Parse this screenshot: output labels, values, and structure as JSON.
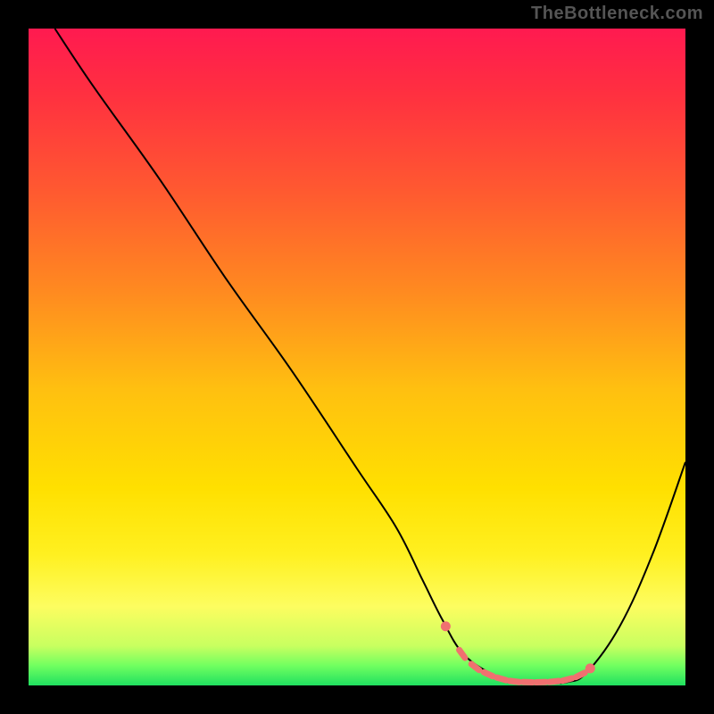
{
  "watermark": "TheBottleneck.com",
  "colors": {
    "background": "#000000",
    "gradient_stops": [
      {
        "offset": 0,
        "color": "#ff1a50"
      },
      {
        "offset": 0.1,
        "color": "#ff3040"
      },
      {
        "offset": 0.25,
        "color": "#ff5a30"
      },
      {
        "offset": 0.4,
        "color": "#ff8a20"
      },
      {
        "offset": 0.55,
        "color": "#ffc010"
      },
      {
        "offset": 0.7,
        "color": "#ffe000"
      },
      {
        "offset": 0.8,
        "color": "#fff020"
      },
      {
        "offset": 0.88,
        "color": "#fdfd60"
      },
      {
        "offset": 0.94,
        "color": "#c8ff60"
      },
      {
        "offset": 0.97,
        "color": "#70ff60"
      },
      {
        "offset": 1.0,
        "color": "#20e060"
      }
    ],
    "curve": "#000000",
    "marker": "#f07070"
  },
  "chart_data": {
    "type": "line",
    "title": "",
    "xlabel": "",
    "ylabel": "",
    "xlim": [
      0,
      100
    ],
    "ylim": [
      0,
      100
    ],
    "grid": false,
    "series": [
      {
        "name": "bottleneck-curve",
        "x": [
          4,
          10,
          20,
          30,
          40,
          50,
          56,
          60,
          63,
          66,
          70,
          74,
          78,
          82,
          85,
          90,
          95,
          100
        ],
        "values": [
          100,
          91,
          77,
          62,
          48,
          33,
          24,
          16,
          10,
          5,
          2,
          0.5,
          0.3,
          0.5,
          2,
          9,
          20,
          34
        ]
      }
    ],
    "annotations": [
      {
        "name": "optimal-range-marker",
        "type": "dotted-segment",
        "x": [
          63.5,
          66,
          68,
          70,
          72,
          74,
          76,
          78,
          80,
          82,
          84,
          85.5
        ],
        "values": [
          9.0,
          4.8,
          2.8,
          1.7,
          1.0,
          0.6,
          0.5,
          0.5,
          0.6,
          0.9,
          1.6,
          2.6
        ],
        "color_key": "marker"
      }
    ]
  }
}
